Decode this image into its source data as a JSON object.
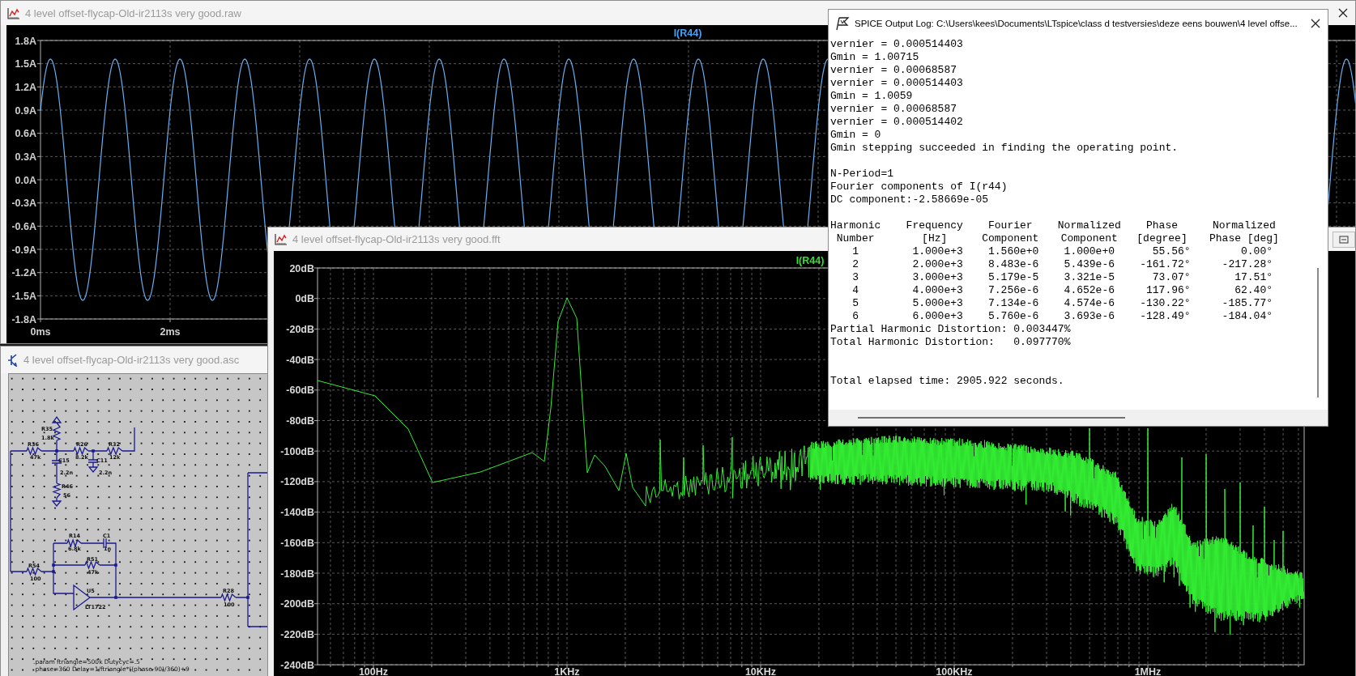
{
  "waveform_window": {
    "title": "4 level offset-flycap-Old-ir2113s very good.raw",
    "active": false,
    "trace_label": "I(R44)",
    "y_ticks": [
      "1.8A",
      "1.5A",
      "1.2A",
      "0.9A",
      "0.6A",
      "0.3A",
      "0.0A",
      "-0.3A",
      "-0.6A",
      "-0.9A",
      "-1.2A",
      "-1.5A",
      "-1.8A"
    ],
    "x_ticks": [
      "0ms",
      "2ms"
    ]
  },
  "output_log": {
    "title": "SPICE Output Log: C:\\Users\\kees\\Documents\\LTspice\\class d testversies\\deze eens bouwen\\4 level offse...",
    "active": true,
    "sections": [
      {
        "kind": "lines",
        "lines": [
          "vernier = 0.000514403",
          "Gmin = 1.00715",
          "vernier = 0.00068587",
          "vernier = 0.000514403",
          "Gmin = 1.0059",
          "vernier = 0.00068587",
          "vernier = 0.000514402",
          "Gmin = 0",
          "Gmin stepping succeeded in finding the operating point."
        ]
      },
      {
        "kind": "lines",
        "lines": [
          "N-Period=1",
          "Fourier components of I(r44)",
          "DC component:-2.58669e-05"
        ]
      },
      {
        "kind": "table",
        "columns": [
          "Harmonic Number",
          "Frequency [Hz]",
          "Fourier Component",
          "Normalized Component",
          "Phase [degree]",
          "Normalized Phase [deg]"
        ],
        "rows": [
          [
            "1",
            "1.000e+3",
            "1.560e+0",
            "1.000e+0",
            "55.56°",
            "0.00°"
          ],
          [
            "2",
            "2.000e+3",
            "8.483e-6",
            "5.439e-6",
            "-161.72°",
            "-217.28°"
          ],
          [
            "3",
            "3.000e+3",
            "5.179e-5",
            "3.321e-5",
            "73.07°",
            "17.51°"
          ],
          [
            "4",
            "4.000e+3",
            "7.256e-6",
            "4.652e-6",
            "117.96°",
            "62.40°"
          ],
          [
            "5",
            "5.000e+3",
            "7.134e-6",
            "4.574e-6",
            "-130.22°",
            "-185.77°"
          ],
          [
            "6",
            "6.000e+3",
            "5.760e-6",
            "3.693e-6",
            "-128.49°",
            "-184.04°"
          ]
        ]
      },
      {
        "kind": "summary",
        "lines": [
          "Partial Harmonic Distortion: 0.003447%",
          "Total Harmonic Distortion:   0.097770%"
        ]
      },
      {
        "kind": "footer",
        "lines": [
          "Total elapsed time: 2905.922 seconds."
        ]
      }
    ]
  },
  "fft_window": {
    "title": "4 level offset-flycap-Old-ir2113s very good.fft",
    "active": false,
    "trace_label": "I(R44)",
    "y_ticks": [
      "20dB",
      "0dB",
      "-20dB",
      "-40dB",
      "-60dB",
      "-80dB",
      "-100dB",
      "-120dB",
      "-140dB",
      "-160dB",
      "-180dB",
      "-200dB",
      "-220dB",
      "-240dB"
    ],
    "x_ticks": [
      "100Hz",
      "1KHz",
      "10KHz",
      "100KHz",
      "1MHz"
    ]
  },
  "schematic_window": {
    "title": "4 level offset-flycap-Old-ir2113s very good.asc",
    "active": false,
    "components": [
      {
        "ref": "R36",
        "value": "47k"
      },
      {
        "ref": "R35",
        "value": "1.8k"
      },
      {
        "ref": "R26",
        "value": "8.2k"
      },
      {
        "ref": "R32",
        "value": "12k"
      },
      {
        "ref": "C15",
        "value": "2.2n"
      },
      {
        "ref": "C11",
        "value": "2.2n"
      },
      {
        "ref": "R46",
        "value": "56"
      },
      {
        "ref": "R14",
        "value": "6.8k"
      },
      {
        "ref": "C1",
        "value": "1n"
      },
      {
        "ref": "R51",
        "value": "47k"
      },
      {
        "ref": "R54",
        "value": "100"
      },
      {
        "ref": "U5",
        "value": "LT1722"
      },
      {
        "ref": "R28",
        "value": "100"
      }
    ],
    "directive": ".param ftriangle=500k Dutycyc=.5 phase=360 Delay=1/ftriangle*((phase-90)/360)+9"
  }
}
